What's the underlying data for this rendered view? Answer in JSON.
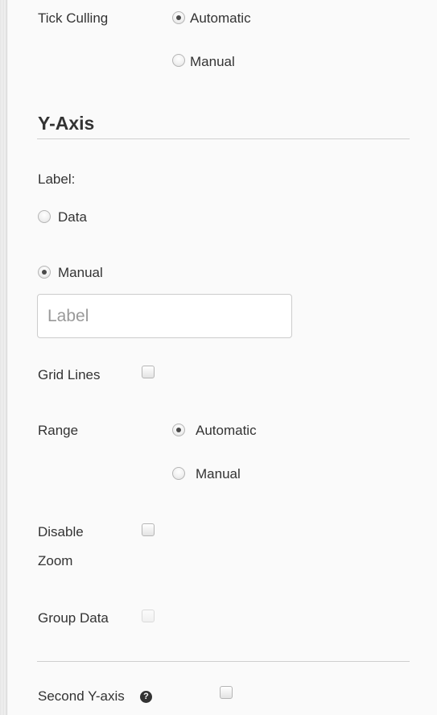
{
  "tick_culling": {
    "label": "Tick Culling",
    "options": [
      {
        "label": "Automatic",
        "selected": true
      },
      {
        "label": "Manual",
        "selected": false
      }
    ]
  },
  "y_axis": {
    "heading": "Y-Axis",
    "label_section": {
      "label": "Label:",
      "options": [
        {
          "label": "Data",
          "selected": false
        },
        {
          "label": "Manual",
          "selected": true
        }
      ],
      "input_placeholder": "Label",
      "input_value": ""
    },
    "grid_lines": {
      "label": "Grid Lines",
      "checked": false
    },
    "range": {
      "label": "Range",
      "options": [
        {
          "label": "Automatic",
          "selected": true
        },
        {
          "label": "Manual",
          "selected": false
        }
      ]
    },
    "disable_zoom": {
      "label_line1": "Disable",
      "label_line2": "Zoom",
      "checked": false
    },
    "group_data": {
      "label": "Group Data",
      "checked": false,
      "disabled": true
    },
    "second_y_axis": {
      "label": "Second Y-axis",
      "help_icon": "question-circle-icon",
      "checked": false
    }
  }
}
